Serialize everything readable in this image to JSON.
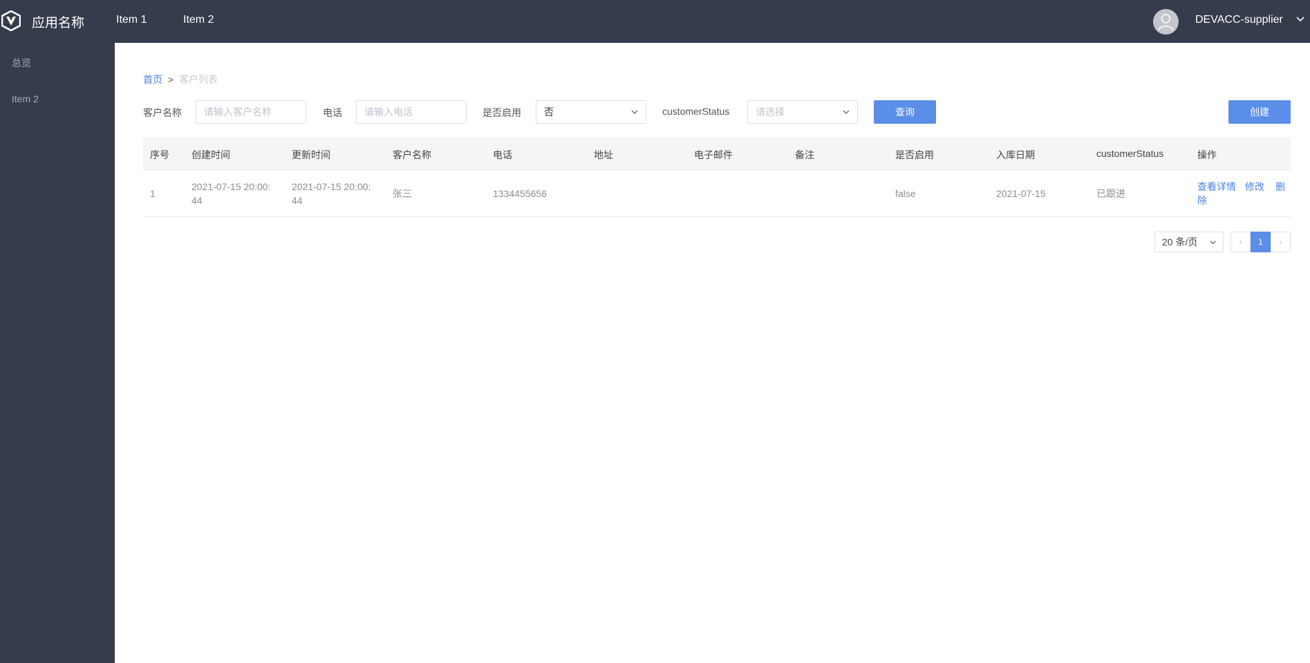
{
  "header": {
    "app_title": "应用名称",
    "nav": [
      "Item 1",
      "Item 2"
    ],
    "username": "DEVACC-supplier",
    "colors": {
      "bar": "#353c4b"
    }
  },
  "sidebar": {
    "items": [
      {
        "label": "总览"
      },
      {
        "label": "Item 2"
      }
    ]
  },
  "breadcrumb": {
    "home": "首页",
    "separator": ">",
    "current": "客户列表"
  },
  "filters": {
    "name_label": "客户名称",
    "name_placeholder": "请输入客户名称",
    "phone_label": "电话",
    "phone_placeholder": "请输入电话",
    "enabled_label": "是否启用",
    "enabled_value": "否",
    "status_label": "customerStatus",
    "status_placeholder": "请选择",
    "query_button": "查询",
    "create_button": "创建"
  },
  "table": {
    "columns": [
      "序号",
      "创建时间",
      "更新时间",
      "客户名称",
      "电话",
      "地址",
      "电子邮件",
      "备注",
      "是否启用",
      "入库日期",
      "customerStatus",
      "操作"
    ],
    "rows": [
      {
        "index": "1",
        "created_line1": "2021-07-15 20:00:",
        "created_line2": "44",
        "updated_line1": "2021-07-15 20:00:",
        "updated_line2": "44",
        "name": "张三",
        "phone": "1334455656",
        "address": "",
        "email": "",
        "remark": "",
        "enabled": "false",
        "stock_date": "2021-07-15",
        "status": "已跟进",
        "actions": {
          "view": "查看详情",
          "edit": "修改",
          "delete_line1": "删",
          "delete_line2": "除"
        }
      }
    ]
  },
  "pagination": {
    "page_size": "20 条/页",
    "prev": "‹",
    "current_page": "1",
    "next": "›"
  }
}
